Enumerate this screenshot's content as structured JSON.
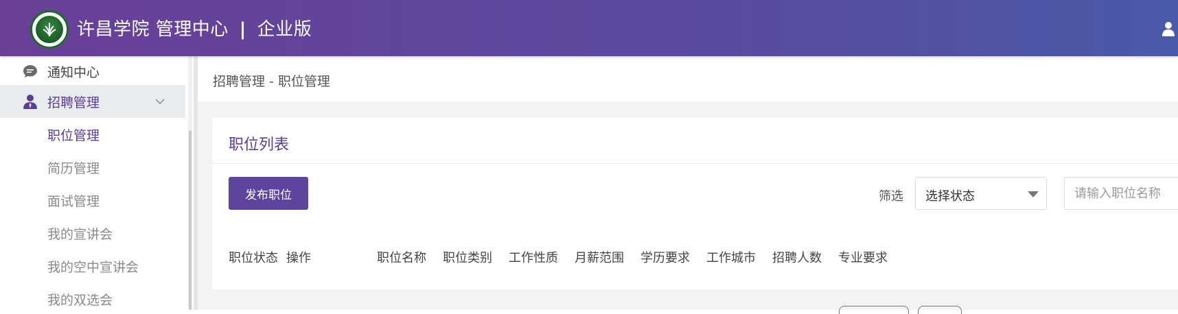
{
  "header": {
    "school": "许昌学院",
    "center": "管理中心",
    "separator": "|",
    "edition": "企业版",
    "logo_icon": "school-emblem-icon",
    "user_icon": "user-icon"
  },
  "sidebar": {
    "items": [
      {
        "label": "通知中心",
        "icon": "chat-bubble-icon"
      },
      {
        "label": "招聘管理",
        "icon": "person-icon",
        "expanded": true
      }
    ],
    "sub_items": [
      {
        "label": "职位管理",
        "current": true
      },
      {
        "label": "简历管理"
      },
      {
        "label": "面试管理"
      },
      {
        "label": "我的宣讲会"
      },
      {
        "label": "我的空中宣讲会"
      },
      {
        "label": "我的双选会"
      }
    ]
  },
  "breadcrumb": "招聘管理 - 职位管理",
  "card": {
    "title": "职位列表",
    "publish_button": "发布职位",
    "filter_label": "筛选",
    "status_select": "选择状态",
    "search_placeholder": "请输入职位名称"
  },
  "table": {
    "columns": [
      "职位状态",
      "操作",
      "职位名称",
      "职位类别",
      "工作性质",
      "月薪范围",
      "学历要求",
      "工作城市",
      "招聘人数",
      "专业要求"
    ]
  },
  "colors": {
    "accent": "#5a3d96",
    "header_start": "#6a3f98",
    "header_end": "#4a5aa8",
    "active_bg": "#e9ecee"
  }
}
